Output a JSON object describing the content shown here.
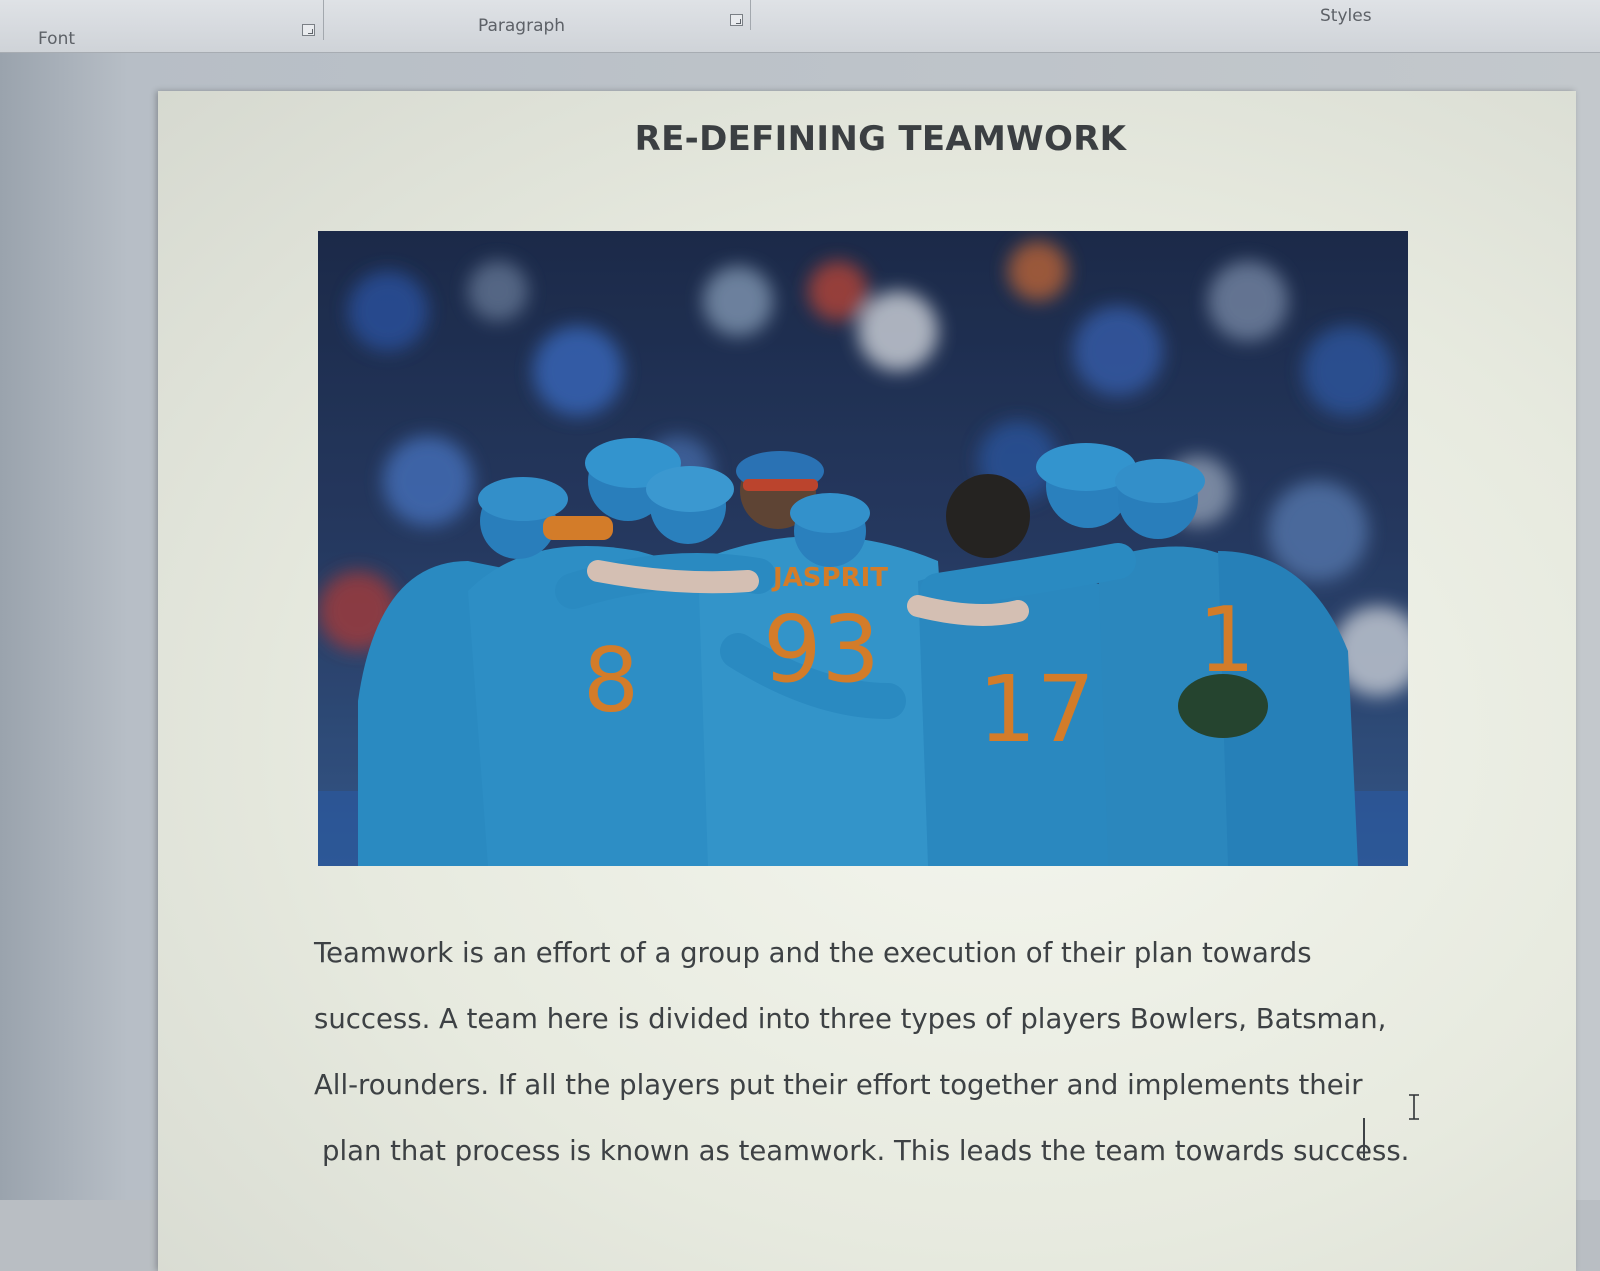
{
  "ribbon": {
    "groups": [
      {
        "label": "Font"
      },
      {
        "label": "Paragraph"
      },
      {
        "label": "Styles"
      }
    ]
  },
  "document": {
    "title": "RE-DEFINING TEAMWORK",
    "image": {
      "jersey_labels": [
        "JASPRIT",
        "93",
        "8",
        "17",
        "1"
      ]
    },
    "paragraph_lines": [
      "Teamwork is an effort of a group and the execution of their plan towards",
      "success. A team here is divided into three types of players Bowlers, Batsman,",
      "All-rounders. If all the players put their effort together and implements their",
      "plan that process is known as teamwork. This leads the team towards success."
    ]
  },
  "colors": {
    "jersey_blue": "#2f9ad6",
    "number_orange": "#f08a2a",
    "title_text": "#3b3f42"
  }
}
